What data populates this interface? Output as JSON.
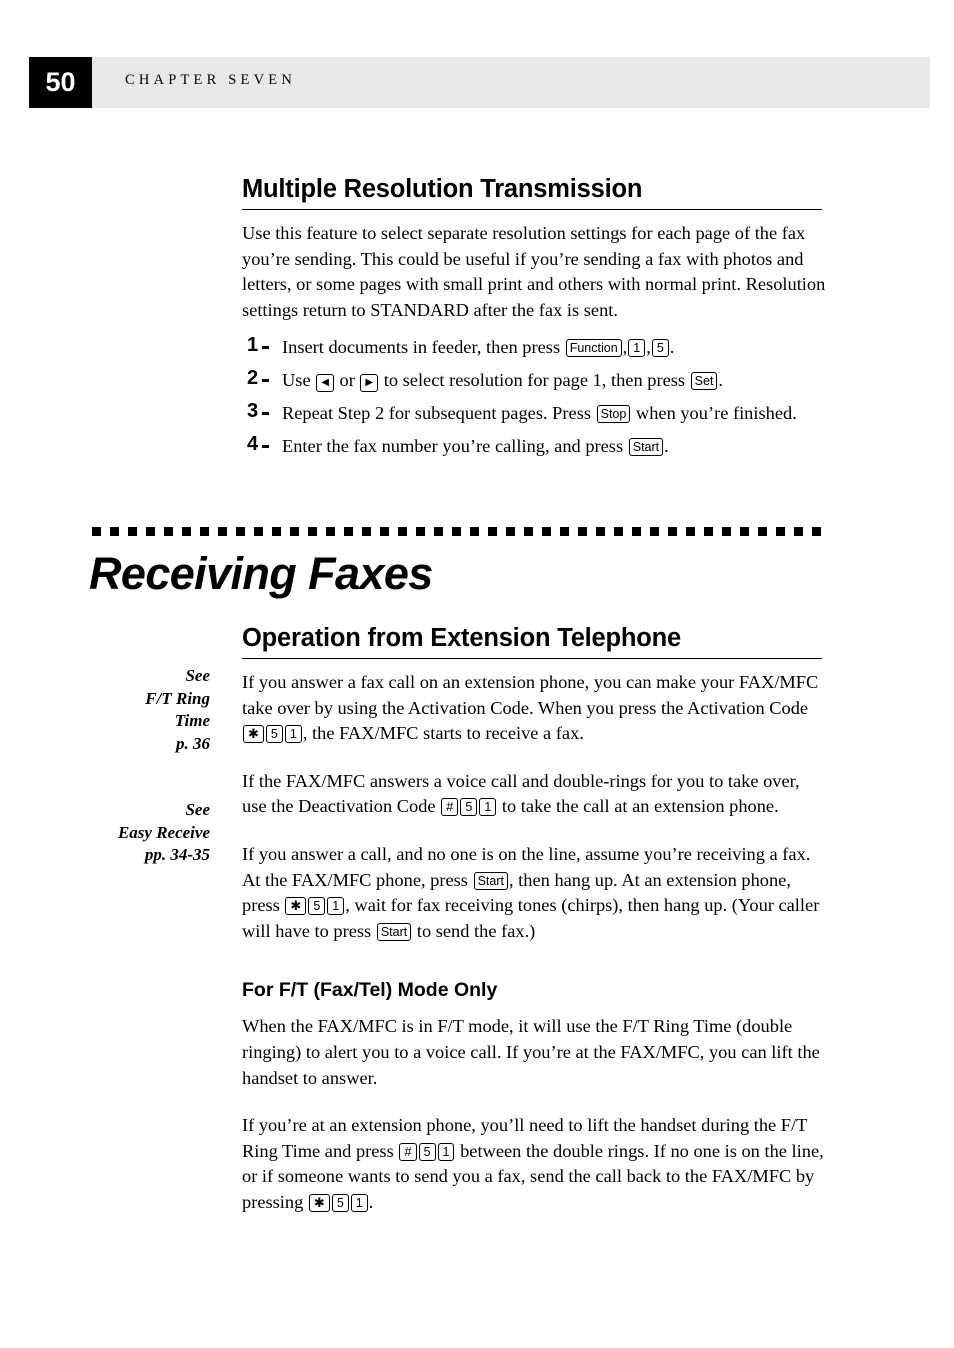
{
  "header": {
    "page_number": "50",
    "chapter_label": "CHAPTER SEVEN"
  },
  "sections": {
    "multi_res": {
      "title": "Multiple Resolution Transmission",
      "intro": "Use this feature to select separate resolution settings for each page of the fax you’re sending.  This could be useful if you’re sending a fax with photos and letters, or some pages with small print and others with normal print.  Resolution settings return to STANDARD after the fax is sent.",
      "steps": [
        {
          "num": "1",
          "pre": "Insert documents in feeder, then press ",
          "keys": [
            "Function",
            "1",
            "5"
          ],
          "post": "."
        },
        {
          "num": "2",
          "pre": "Use ",
          "keys": [
            "◀",
            "▶"
          ],
          "mid": " or ",
          "post": " to select resolution for page 1, then press ",
          "key_end": "Set",
          "tail": "."
        },
        {
          "num": "3",
          "pre": "Repeat Step 2 for subsequent pages.  Press ",
          "key_end": "Stop",
          "post": " when you’re finished."
        },
        {
          "num": "4",
          "pre": "Enter the fax number you’re calling, and press ",
          "key_end": "Start",
          "post": "."
        }
      ]
    },
    "receiving_faxes": {
      "heading": "Receiving Faxes"
    },
    "extension_phone": {
      "title": "Operation from Extension Telephone",
      "para1_a": "If you answer a fax call on an extension phone, you can make your FAX/MFC take over by using the Activation Code. When you press the Activation Code ",
      "para1_keys": [
        "✱",
        "5",
        "1"
      ],
      "para1_b": ", the FAX/MFC starts to receive a fax.",
      "para2_a": "If the FAX/MFC answers a voice call and double-rings for you to take over, use the Deactivation Code ",
      "para2_keys": [
        "#",
        "5",
        "1"
      ],
      "para2_b": " to take the call at an extension phone.",
      "para3_a": "If you answer a call, and no one is on the line, assume you’re receiving a fax. At the FAX/MFC phone, press ",
      "para3_key1": "Start",
      "para3_b": ", then hang up. At an extension phone, press ",
      "para3_keys": [
        "✱",
        "5",
        "1"
      ],
      "para3_c": ", wait for fax receiving tones (chirps), then hang up. (Your caller will have to press ",
      "para3_key2": "Start",
      "para3_d": " to send the fax.)"
    },
    "ft_mode": {
      "title": "For F/T (Fax/Tel) Mode Only",
      "para1": "When the FAX/MFC is in F/T mode, it will use the F/T Ring Time (double ringing) to alert you to a voice call. If you’re at the FAX/MFC, you can lift the handset to answer.",
      "para2_a": "If you’re at an extension phone, you’ll need to lift the handset during the F/T Ring Time and press ",
      "para2_keys": [
        "#",
        "5",
        "1"
      ],
      "para2_b": " between the double rings. If no one is on the line, or if someone wants to send you a fax, send the call back to the FAX/MFC by pressing ",
      "para2_keys2": [
        "✱",
        "5",
        "1"
      ],
      "para2_c": "."
    }
  },
  "margin_notes": [
    {
      "line1": "See",
      "line2": "F/T Ring",
      "line3": "Time",
      "line4": "p. 36"
    },
    {
      "line1": "See",
      "line2": "Easy Receive",
      "line3": "pp. 34-35"
    }
  ]
}
